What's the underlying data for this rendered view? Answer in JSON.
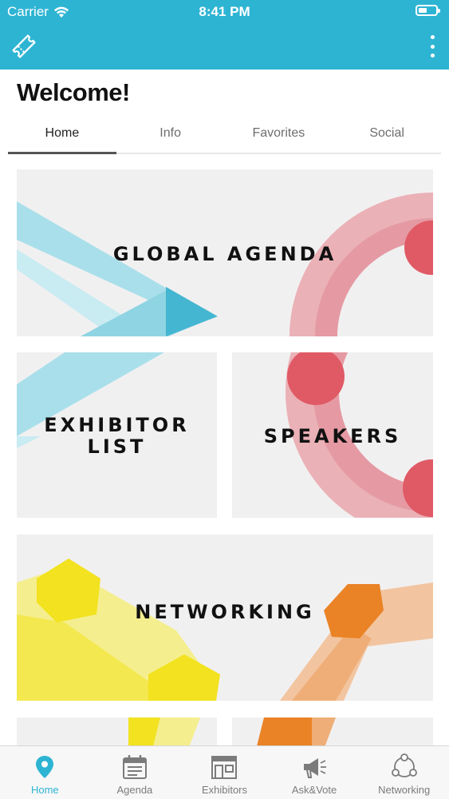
{
  "status_bar": {
    "carrier": "Carrier",
    "time": "8:41 PM"
  },
  "app_bar": {
    "left_icon": "ticket-icon",
    "right_icon": "more-vertical-icon"
  },
  "page": {
    "title": "Welcome!"
  },
  "tabs": [
    {
      "label": "Home",
      "active": true
    },
    {
      "label": "Info",
      "active": false
    },
    {
      "label": "Favorites",
      "active": false
    },
    {
      "label": "Social",
      "active": false
    }
  ],
  "tiles": {
    "global_agenda": "GLOBAL AGENDA",
    "exhibitor_list_line1": "EXHIBITOR",
    "exhibitor_list_line2": "LIST",
    "speakers": "SPEAKERS",
    "networking": "NETWORKING"
  },
  "bottom_nav": [
    {
      "label": "Home",
      "icon": "map-pin-icon",
      "active": true
    },
    {
      "label": "Agenda",
      "icon": "calendar-icon",
      "active": false
    },
    {
      "label": "Exhibitors",
      "icon": "storefront-icon",
      "active": false
    },
    {
      "label": "Ask&Vote",
      "icon": "megaphone-icon",
      "active": false
    },
    {
      "label": "Networking",
      "icon": "network-icon",
      "active": false
    }
  ],
  "colors": {
    "brand": "#2eb4d3",
    "teal_shape": "#6cc9dc",
    "red_shape": "#e05a66",
    "yellow_shape": "#f2e21f",
    "orange_shape": "#ea8326",
    "tile_bg": "#f1f0f1"
  }
}
